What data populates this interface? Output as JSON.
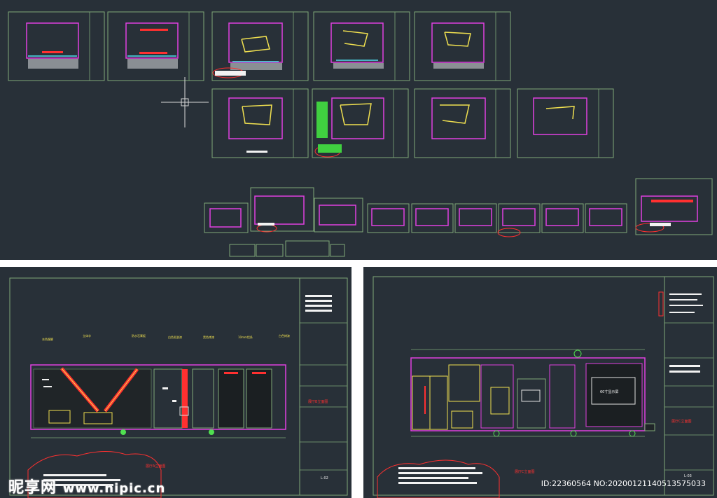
{
  "watermark": {
    "brand": "昵享网",
    "url": "www.nipic.cn",
    "image_id": "ID:22360564 NO:20200121140513575033"
  },
  "left_drawing": {
    "title": "展厅A立面图",
    "sheet_code": "L-02",
    "title_block_label": "展厅B立面图",
    "top_labels": [
      "灰色踢脚",
      "立体字",
      "防水石膏板",
      "白色乳胶漆",
      "黑色烤漆",
      "10mm铝条",
      "白色烤漆"
    ]
  },
  "right_drawing": {
    "title": "展厅C立面图",
    "sheet_code": "L-03",
    "title_block_label": "展厅C立面图",
    "screen_label": "60寸显示屏"
  },
  "colors": {
    "background": "#283038",
    "frame": "#7fa878",
    "magenta": "#e040e0",
    "yellow": "#f0e050",
    "red": "#ff3030",
    "cyan": "#50e0f0"
  }
}
